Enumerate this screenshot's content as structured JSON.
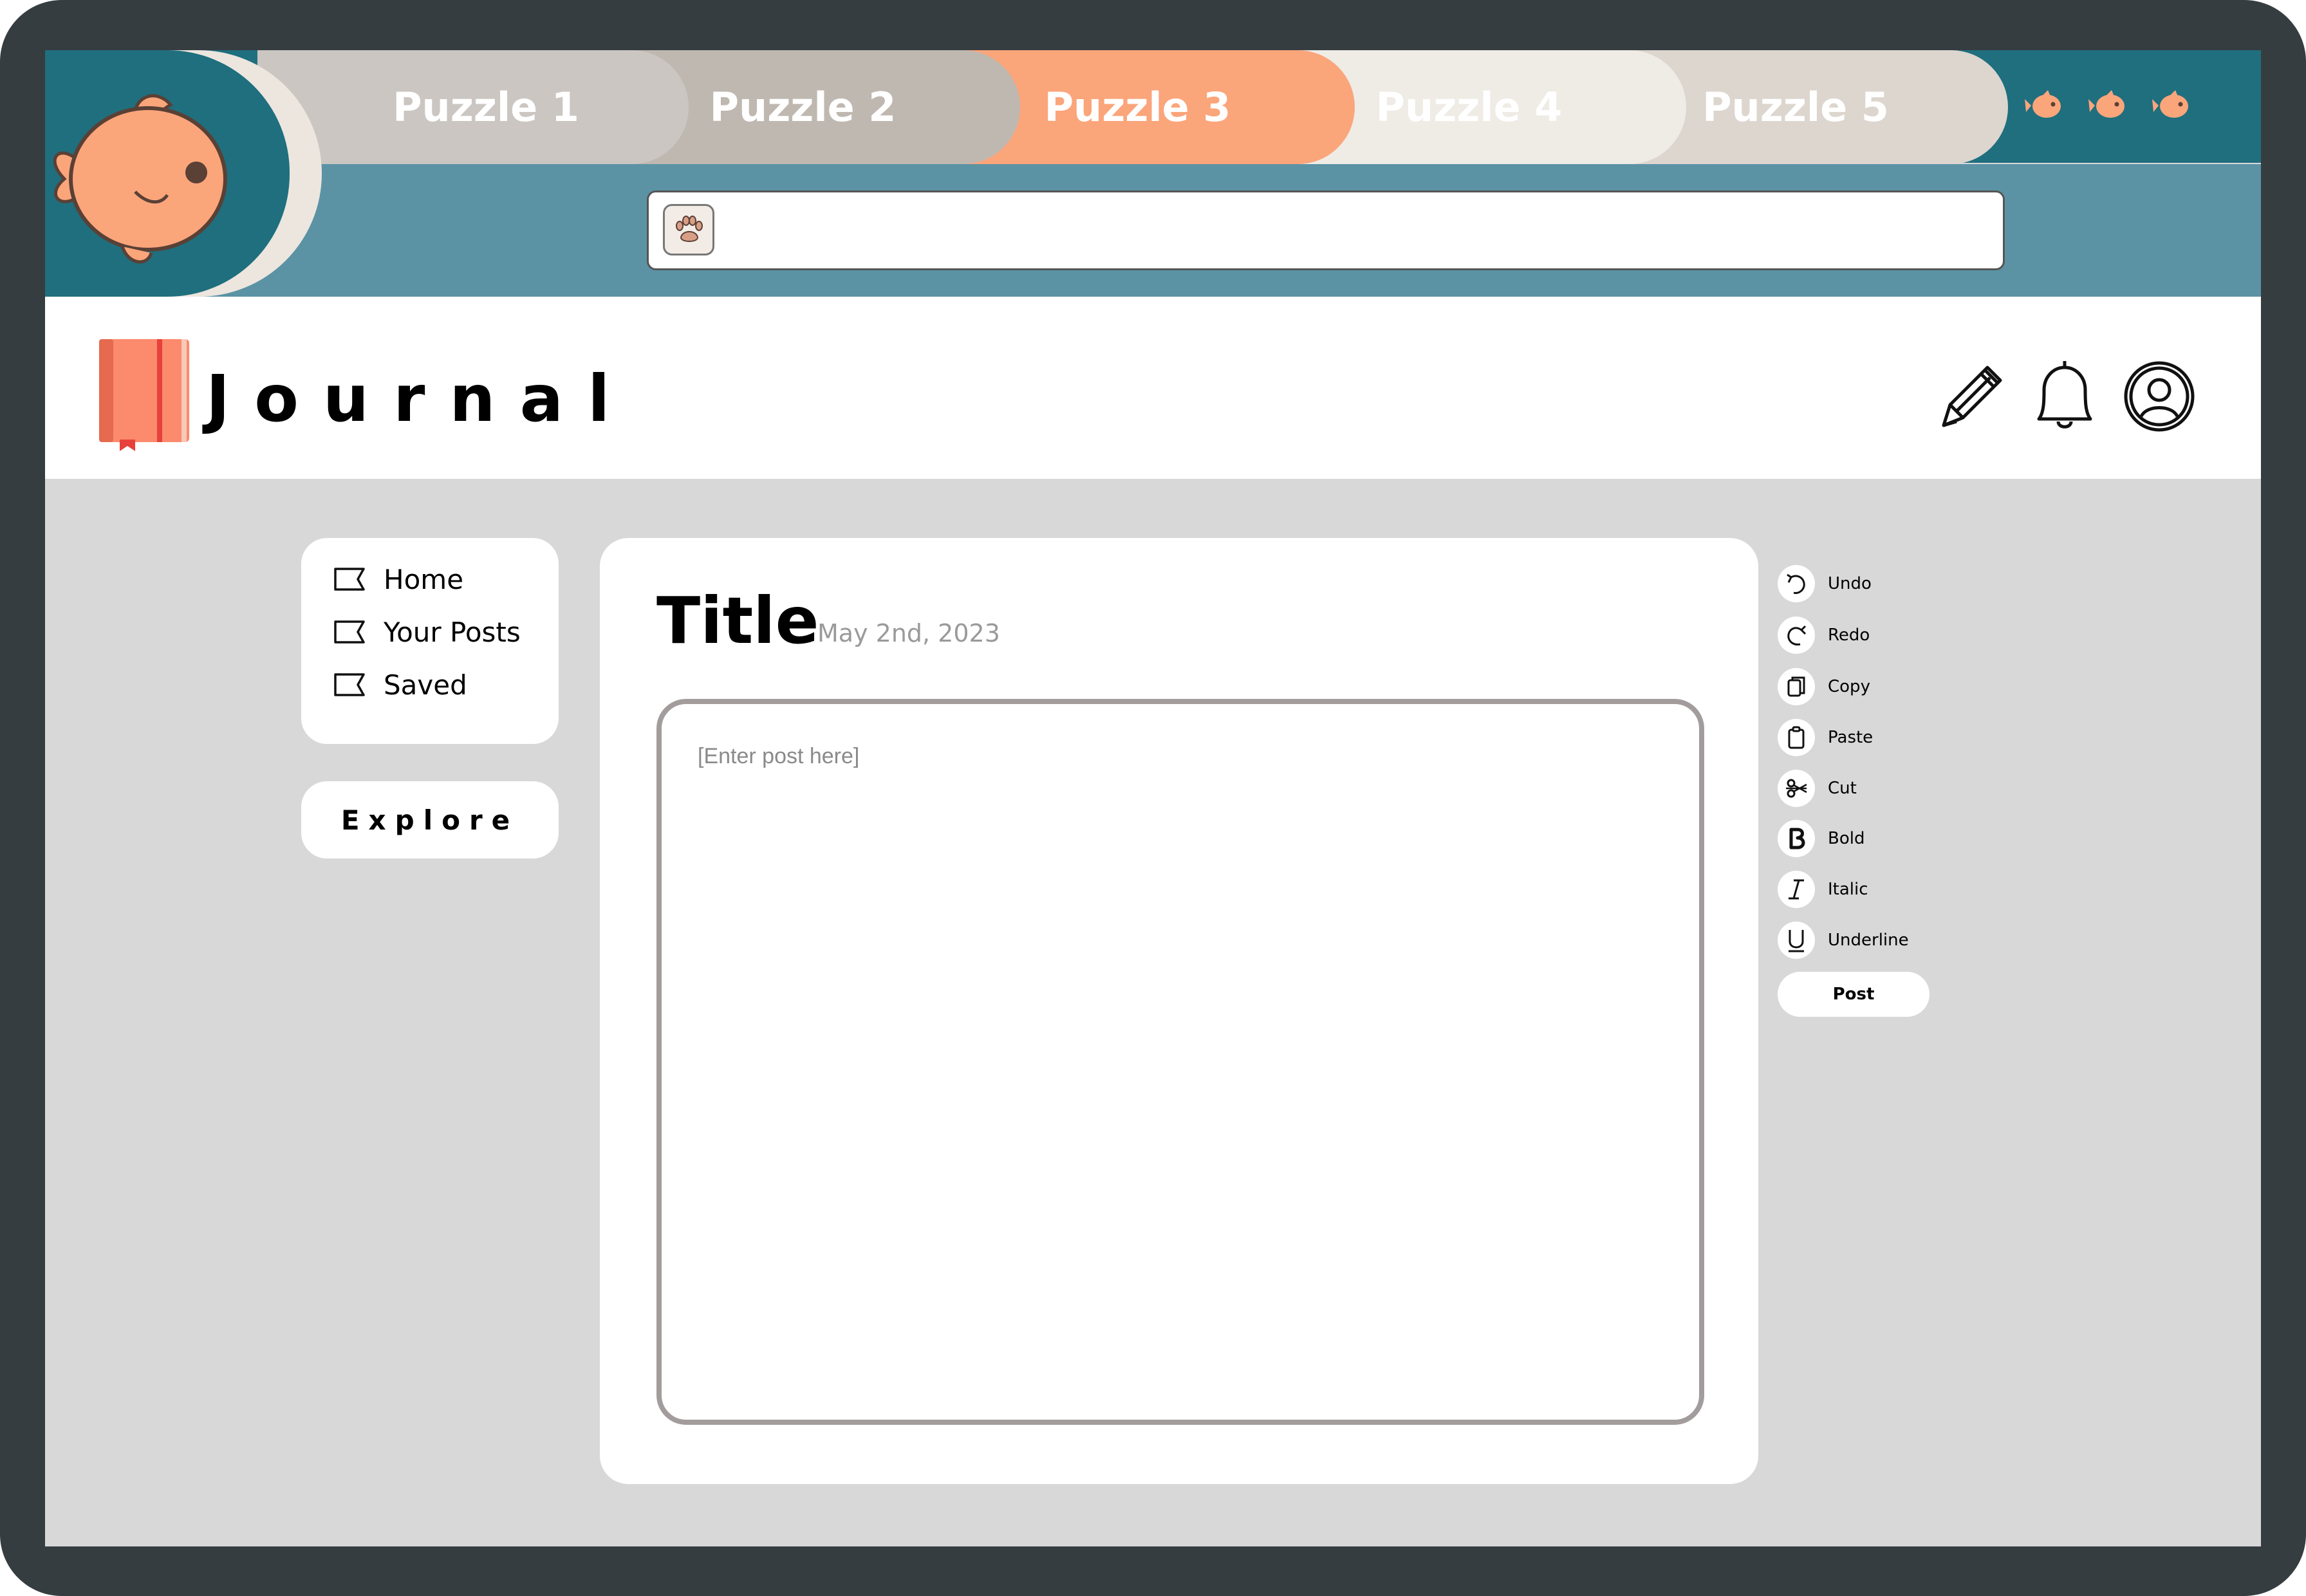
{
  "tabs": [
    {
      "label": "Puzzle 1"
    },
    {
      "label": "Puzzle 2"
    },
    {
      "label": "Puzzle 3",
      "active": true
    },
    {
      "label": "Puzzle 4"
    },
    {
      "label": "Puzzle 5"
    }
  ],
  "window_controls": [
    "fish-icon",
    "fish-icon",
    "fish-icon"
  ],
  "address_bar": {
    "value": "",
    "button_icon": "paw-icon"
  },
  "app": {
    "title": "Journal",
    "logo_icon": "book-icon"
  },
  "header_icons": [
    "pencil-icon",
    "bell-icon",
    "profile-icon"
  ],
  "nav": {
    "items": [
      {
        "label": "Home"
      },
      {
        "label": "Your Posts"
      },
      {
        "label": "Saved"
      }
    ],
    "explore_label": "Explore"
  },
  "editor": {
    "title": "Title",
    "date": "May 2nd, 2023",
    "placeholder": "[Enter post here]"
  },
  "toolbar": {
    "items": [
      {
        "label": "Undo",
        "icon": "undo-icon"
      },
      {
        "label": "Redo",
        "icon": "redo-icon"
      },
      {
        "label": "Copy",
        "icon": "copy-icon"
      },
      {
        "label": "Paste",
        "icon": "paste-icon"
      },
      {
        "label": "Cut",
        "icon": "scissors-icon"
      },
      {
        "label": "Bold",
        "icon": "bold-icon"
      },
      {
        "label": "Italic",
        "icon": "italic-icon"
      },
      {
        "label": "Underline",
        "icon": "underline-icon"
      }
    ],
    "post_label": "Post"
  },
  "colors": {
    "frame": "#363d41",
    "tabbar": "#1f6f7e",
    "address_bar": "#5b93a5",
    "accent": "#fba57b",
    "content_bg": "#d8d8d8"
  }
}
